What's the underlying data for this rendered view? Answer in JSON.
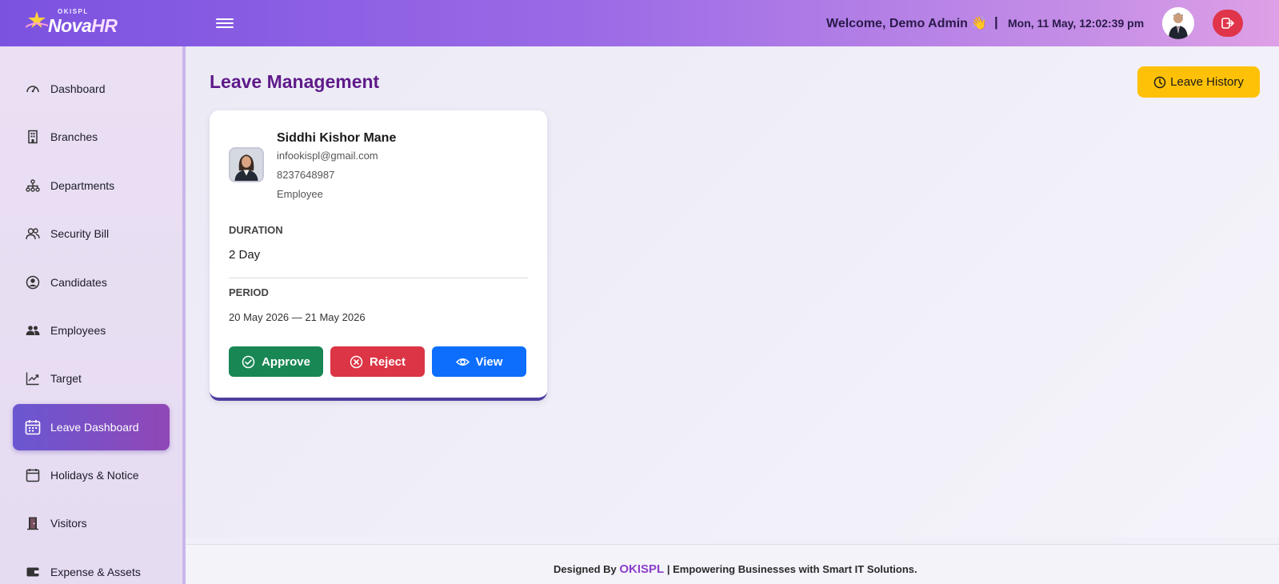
{
  "header": {
    "logo_small": "OKISPL",
    "logo_nova": "Nova",
    "logo_hr": "HR",
    "welcome": "Welcome, Demo Admin 👋",
    "separator": "|",
    "datetime": "Mon, 11 May, 12:02:39 pm"
  },
  "sidebar": {
    "items": [
      {
        "label": "Dashboard",
        "icon": "gauge-icon"
      },
      {
        "label": "Branches",
        "icon": "building-icon"
      },
      {
        "label": "Departments",
        "icon": "org-chart-icon"
      },
      {
        "label": "Security Bill",
        "icon": "people-icon"
      },
      {
        "label": "Candidates",
        "icon": "user-circle-icon"
      },
      {
        "label": "Employees",
        "icon": "users-icon"
      },
      {
        "label": "Target",
        "icon": "trend-icon"
      },
      {
        "label": "Leave Dashboard",
        "icon": "calendar-grid-icon",
        "active": true
      },
      {
        "label": "Holidays & Notice",
        "icon": "calendar-icon"
      },
      {
        "label": "Visitors",
        "icon": "door-icon"
      },
      {
        "label": "Expense & Assets",
        "icon": "wallet-icon"
      }
    ]
  },
  "main": {
    "title": "Leave Management",
    "history_button": "Leave History",
    "card": {
      "name": "Siddhi Kishor Mane",
      "email": "infookispl@gmail.com",
      "phone": "8237648987",
      "role": "Employee",
      "duration_label": "DURATION",
      "duration_value": "2 Day",
      "period_label": "PERIOD",
      "period_value": "20 May 2026 — 21 May 2026",
      "approve_label": "Approve",
      "reject_label": "Reject",
      "view_label": "View"
    }
  },
  "footer": {
    "prefix": "Designed By",
    "brand": "OKISPL",
    "suffix": "| Empowering Businesses with Smart IT Solutions."
  },
  "colors": {
    "accent": "#5e1a8a",
    "approve": "#198754",
    "reject": "#dc3545",
    "view": "#0d6efd",
    "history": "#ffc107",
    "logout": "#e0344a"
  }
}
